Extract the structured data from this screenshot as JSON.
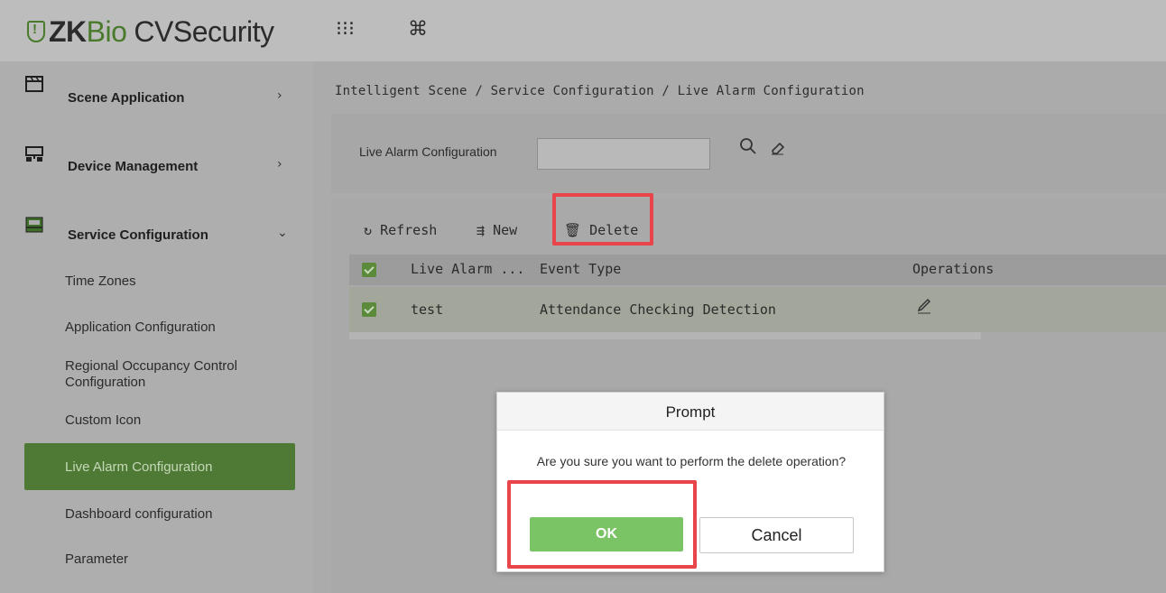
{
  "app": {
    "brand_zk": "ZK",
    "brand_bio": "Bio",
    "brand_rest": "CVSecurity",
    "apps_icon": "grid-dots-icon",
    "shortcut_icon": "command-icon"
  },
  "sidebar": {
    "menus": [
      {
        "label": "Scene Application",
        "icon": "scene-application-icon",
        "chevron": "›"
      },
      {
        "label": "Device Management",
        "icon": "device-management-icon",
        "chevron": "›"
      },
      {
        "label": "Service Configuration",
        "icon": "service-configuration-icon",
        "chevron": "⌄"
      }
    ],
    "subitems": [
      {
        "label": "Time Zones"
      },
      {
        "label": "Application Configuration"
      },
      {
        "label": "Regional Occupancy Control Configuration"
      },
      {
        "label": "Custom Icon"
      },
      {
        "label": "Live Alarm Configuration"
      },
      {
        "label": "Dashboard configuration"
      },
      {
        "label": "Parameter"
      }
    ],
    "active_index": 4
  },
  "breadcrumb": "Intelligent Scene / Service Configuration / Live Alarm Configuration",
  "search": {
    "label": "Live Alarm Configuration",
    "value": "",
    "search_icon": "search-icon",
    "clear_icon": "eraser-icon"
  },
  "toolbar": {
    "refresh": "Refresh",
    "new": "New",
    "delete": "Delete"
  },
  "table": {
    "columns": [
      "Live Alarm ...",
      "Event Type",
      "Operations"
    ],
    "rows": [
      {
        "name": "test",
        "event_type": "Attendance Checking Detection",
        "op_icon": "edit-icon",
        "checked": true
      }
    ],
    "header_checked": true
  },
  "dialog": {
    "title": "Prompt",
    "message": "Are you sure you want to perform the delete operation?",
    "ok": "OK",
    "cancel": "Cancel"
  },
  "colors": {
    "highlight": "#e8444a",
    "accent_green": "#4f7a35",
    "ok_button": "#7bc466"
  }
}
